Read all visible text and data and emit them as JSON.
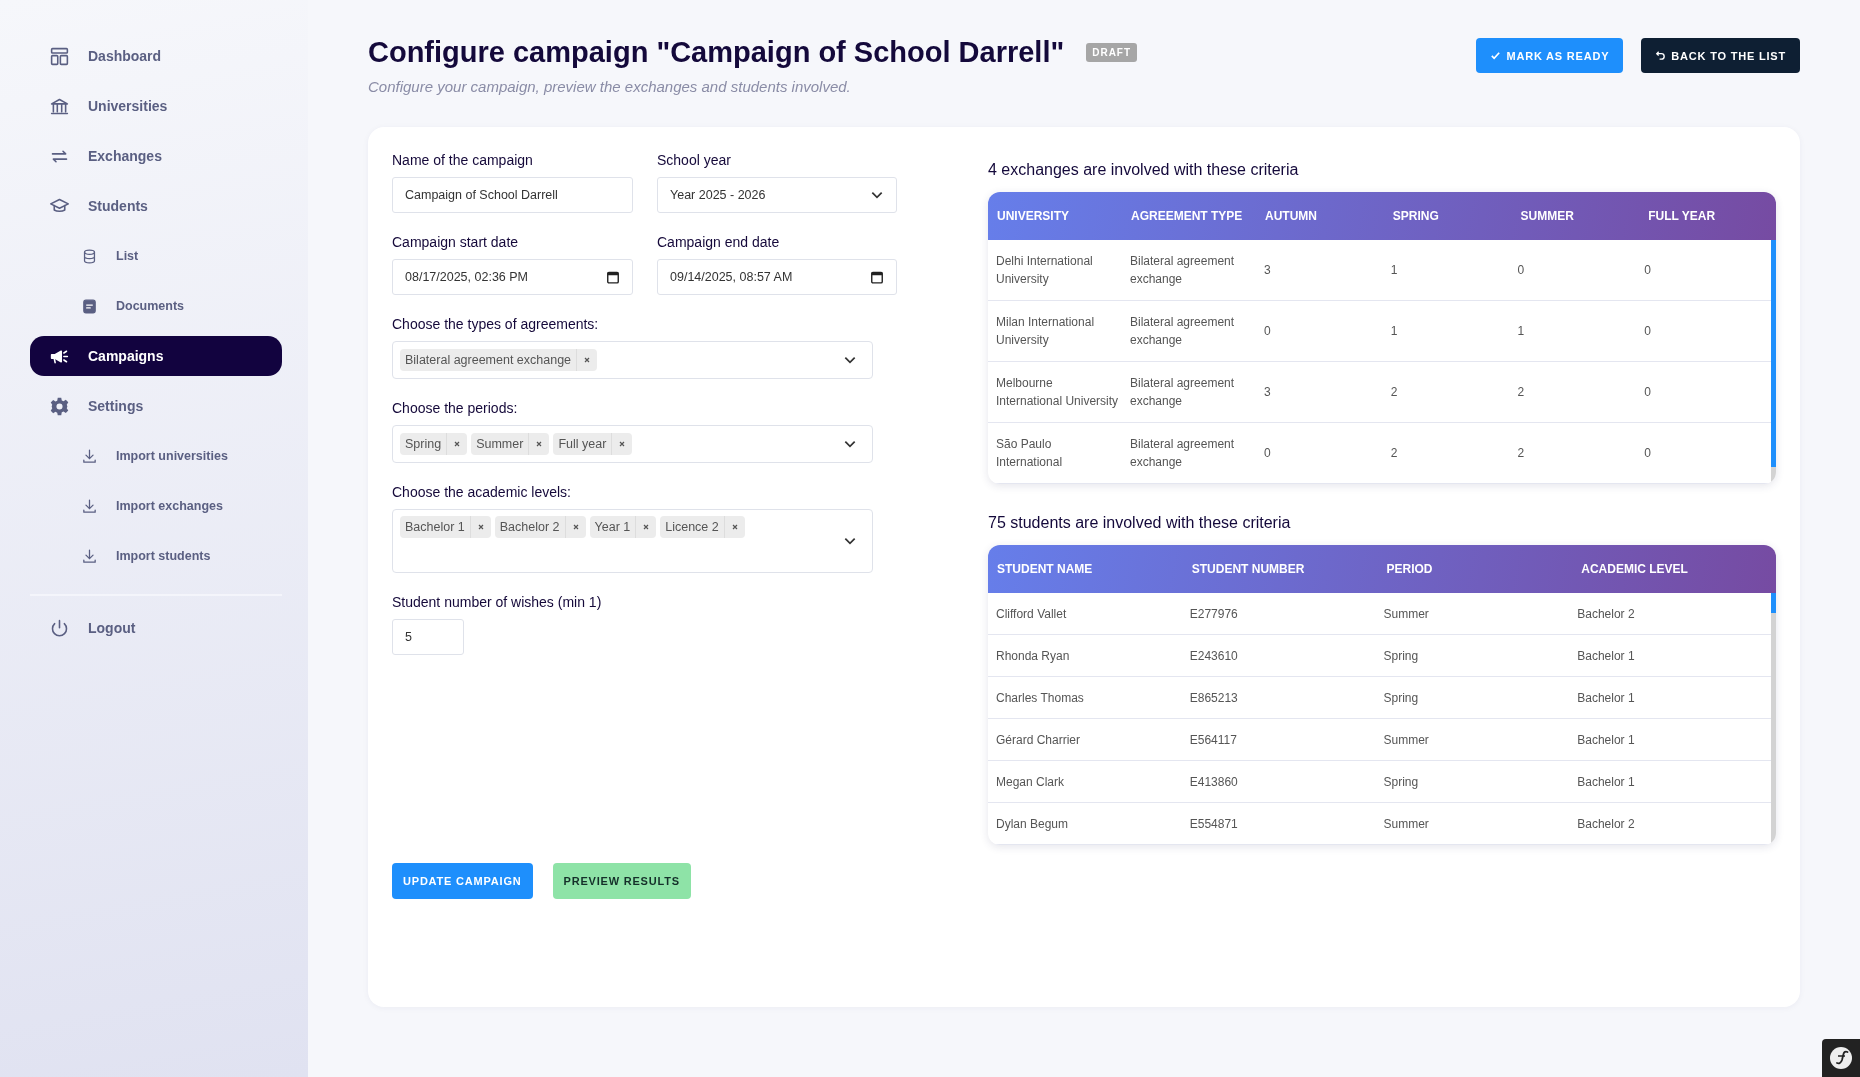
{
  "sidebar": {
    "items": [
      {
        "label": "Dashboard",
        "kind": "main",
        "selected": false
      },
      {
        "label": "Universities",
        "kind": "main",
        "selected": false
      },
      {
        "label": "Exchanges",
        "kind": "main",
        "selected": false
      },
      {
        "label": "Students",
        "kind": "main",
        "selected": false
      },
      {
        "label": "List",
        "kind": "sub",
        "selected": false
      },
      {
        "label": "Documents",
        "kind": "sub",
        "selected": false
      },
      {
        "label": "Campaigns",
        "kind": "main",
        "selected": true
      },
      {
        "label": "Settings",
        "kind": "main",
        "selected": false
      },
      {
        "label": "Import universities",
        "kind": "sub",
        "selected": false
      },
      {
        "label": "Import exchanges",
        "kind": "sub",
        "selected": false
      },
      {
        "label": "Import students",
        "kind": "sub",
        "selected": false
      }
    ],
    "footer_item": {
      "label": "Logout"
    }
  },
  "header": {
    "title": "Configure campaign \"Campaign of School Darrell\"",
    "badge": "DRAFT",
    "subtitle": "Configure your campaign, preview the exchanges and students involved.",
    "buttons": [
      {
        "label": "MARK AS READY",
        "kind": "primary"
      },
      {
        "label": "BACK TO THE LIST",
        "kind": "dark"
      }
    ]
  },
  "form": {
    "name": {
      "label": "Name of the campaign",
      "value": "Campaign of School Darrell"
    },
    "school_year": {
      "label": "School year",
      "value": "Year 2025 - 2026"
    },
    "start_date": {
      "label": "Campaign start date",
      "value": "08/17/2025, 02:36 PM"
    },
    "end_date": {
      "label": "Campaign end date",
      "value": "09/14/2025, 08:57 AM"
    },
    "multiselects": [
      {
        "label": "Choose the types of agreements:",
        "tags": [
          "Bilateral agreement exchange"
        ]
      },
      {
        "label": "Choose the periods:",
        "tags": [
          "Spring",
          "Summer",
          "Full year"
        ]
      },
      {
        "label": "Choose the academic levels:",
        "tags": [
          "Bachelor 1",
          "Bachelor 2",
          "Year 1",
          "Licence 2"
        ]
      }
    ],
    "wishes": {
      "label": "Student number of wishes (min 1)",
      "value": "5"
    },
    "buttons": [
      {
        "label": "UPDATE CAMPAIGN",
        "kind": "primary"
      },
      {
        "label": "PREVIEW RESULTS",
        "kind": "success"
      }
    ]
  },
  "exchanges": {
    "heading": "4 exchanges are involved with these criteria",
    "columns": [
      "UNIVERSITY",
      "AGREEMENT TYPE",
      "AUTUMN",
      "SPRING",
      "SUMMER",
      "FULL YEAR"
    ],
    "rows": [
      [
        "Delhi International University",
        "Bilateral agreement exchange",
        "3",
        "1",
        "0",
        "0"
      ],
      [
        "Milan International University",
        "Bilateral agreement exchange",
        "0",
        "1",
        "1",
        "0"
      ],
      [
        "Melbourne International University",
        "Bilateral agreement exchange",
        "3",
        "2",
        "2",
        "0"
      ],
      [
        "São Paulo International",
        "Bilateral agreement exchange",
        "0",
        "2",
        "2",
        "0"
      ]
    ]
  },
  "students": {
    "heading": "75 students are involved with these criteria",
    "columns": [
      "STUDENT NAME",
      "STUDENT NUMBER",
      "PERIOD",
      "ACADEMIC LEVEL"
    ],
    "rows": [
      [
        "Clifford Vallet",
        "E277976",
        "Summer",
        "Bachelor 2"
      ],
      [
        "Rhonda Ryan",
        "E243610",
        "Spring",
        "Bachelor 1"
      ],
      [
        "Charles Thomas",
        "E865213",
        "Spring",
        "Bachelor 1"
      ],
      [
        "Gérard Charrier",
        "E564117",
        "Summer",
        "Bachelor 1"
      ],
      [
        "Megan Clark",
        "E413860",
        "Spring",
        "Bachelor 1"
      ],
      [
        "Dylan Begum",
        "E554871",
        "Summer",
        "Bachelor 2"
      ]
    ]
  }
}
